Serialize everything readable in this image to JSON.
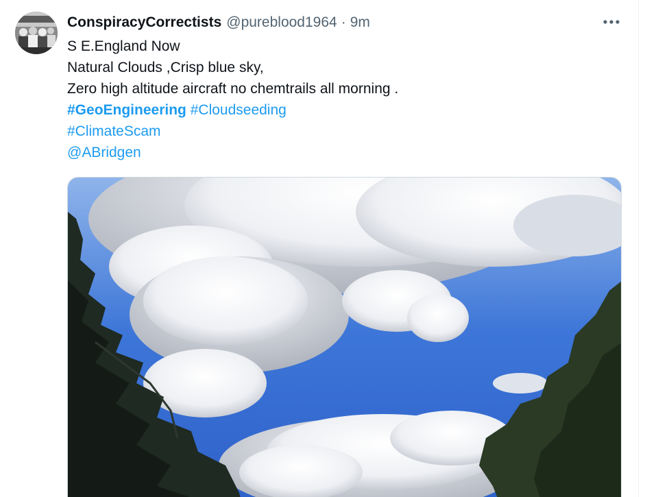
{
  "tweet": {
    "display_name": "ConspiracyCorrectists",
    "handle": "@pureblood1964",
    "separator": "·",
    "time": "9m",
    "more_label": "•••",
    "avatar_icon": "avatar-photo",
    "lines": [
      "S E.England Now",
      "Natural Clouds ,Crisp blue sky,",
      "Zero high altitude aircraft no chemtrails all morning ."
    ],
    "hashtags_line": {
      "tag1": "#GeoEngineering",
      "tag2": "#Cloudseeding"
    },
    "hashtag3": "#ClimateScam",
    "mention": "@ABridgen"
  },
  "colors": {
    "link": "#1d9bf0",
    "text": "#0f1419",
    "secondary": "#536471"
  }
}
